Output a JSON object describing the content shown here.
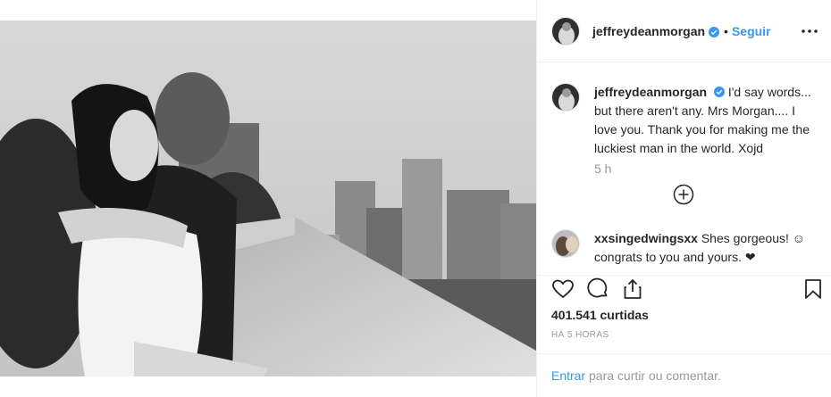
{
  "post": {
    "username": "jeffreydeanmorgan",
    "follow_label": "Seguir",
    "dot": "•",
    "caption": "I'd say words... but there aren't any. Mrs Morgan.... I love you. Thank you for making me the luckiest man in the world. Xojd",
    "caption_time": "5 h"
  },
  "comment": {
    "username": "xxsingedwingsxx",
    "text": "Shes gorgeous! ☺ congrats to you and yours. ❤"
  },
  "stats": {
    "likes": "401.541 curtidas",
    "time_ago": "HÁ 5 HORAS"
  },
  "login_prompt": {
    "link": "Entrar",
    "text": " para curtir ou comentar."
  },
  "icons": {
    "verified": "verified-badge-icon",
    "more": "more-options-icon",
    "load_more": "plus-circle-icon",
    "like": "heart-icon",
    "comment": "comment-bubble-icon",
    "share": "share-icon",
    "save": "bookmark-icon"
  },
  "colors": {
    "link_blue": "#3897f0",
    "verified_blue": "#3897f0",
    "muted_gray": "#999999",
    "text": "#262626"
  }
}
